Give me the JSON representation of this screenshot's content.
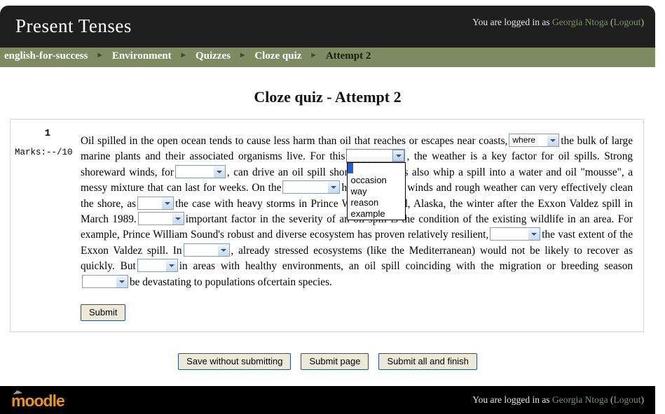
{
  "header": {
    "site_title": "Present Tenses",
    "logged_in_prefix": "You are logged in as",
    "user_name": "Georgia Ntoga",
    "logout_label": "Logout"
  },
  "breadcrumb": {
    "separator": "▶",
    "items": [
      {
        "label": "english-for-success",
        "current": false
      },
      {
        "label": "Environment",
        "current": false
      },
      {
        "label": "Quizzes",
        "current": false
      },
      {
        "label": "Cloze quiz",
        "current": false
      },
      {
        "label": "Attempt 2",
        "current": true
      }
    ]
  },
  "page": {
    "title": "Cloze quiz - Attempt 2"
  },
  "question": {
    "number": "1",
    "marks_label": "Marks:",
    "marks_value": "--/10",
    "text": {
      "t1": "Oil spilled in the open ocean tends to cause less harm than oil that reaches or escapes near coasts,",
      "t2": "the bulk of large marine plants and their associated organisms live. For this",
      "t3": ", the weather is a key factor for oil spills. Strong shoreward winds, for",
      "t4": ", can drive an oil spill shoreward. Winds also whip a spill into a water and oil \"mousse\", a messy mixture that can last for weeks. On the",
      "t5": "hand, offshore winds and rough weather can very effectively clean the shore, as",
      "t6": "the case with heavy storms in Prince William Sound, Alaska, the winter after the Exxon Valdez spill in March 1989.",
      "t7": "important factor in the severity of an oil spill is the condition of the existing wildlife in an area. For example, Prince William Sound's robust and diverse ecosystem has proven relatively resilient,",
      "t8": "the vast extent of the Exxon Valdez spill. In",
      "t9": ", already stressed ecosystems (like the Mediterranean) would not be likely to recover as quickly. But",
      "t10": "in areas with healthy environments, an oil spill coinciding with the migration or breeding season",
      "t11": "be devastating to populations ofcertain species."
    },
    "blanks": [
      {
        "id": "blank-where",
        "value": "where",
        "state": "closed"
      },
      {
        "id": "blank-reason",
        "value": "",
        "state": "open"
      },
      {
        "id": "blank-example",
        "value": "",
        "state": "closed"
      },
      {
        "id": "blank-other",
        "value": "",
        "state": "closed"
      },
      {
        "id": "blank-was",
        "value": "",
        "state": "closed"
      },
      {
        "id": "blank-another",
        "value": "",
        "state": "closed"
      },
      {
        "id": "blank-despite",
        "value": "",
        "state": "closed"
      },
      {
        "id": "blank-contrast",
        "value": "",
        "state": "closed"
      },
      {
        "id": "blank-even",
        "value": "",
        "state": "closed"
      },
      {
        "id": "blank-could",
        "value": "",
        "state": "closed"
      }
    ],
    "open_dropdown_options": [
      "",
      "occasion",
      "way",
      "reason",
      "example"
    ],
    "submit_label": "Submit"
  },
  "actions": {
    "save_without_submitting": "Save without submitting",
    "submit_page": "Submit page",
    "submit_all_and_finish": "Submit all and finish"
  },
  "footer": {
    "logo_text": "moodle",
    "logged_in_prefix": "You are logged in as",
    "user_name": "Georgia Ntoga",
    "logout_label": "Logout"
  },
  "colors": {
    "header_bg": "#1f1f1f",
    "breadcrumb_bg": "#7d8b62",
    "link_green": "#7e9160",
    "footer_bg": "#000000",
    "logo_orange": "#e8922a",
    "select_border": "#7f9db9",
    "option_highlight": "#2a5cc8"
  }
}
